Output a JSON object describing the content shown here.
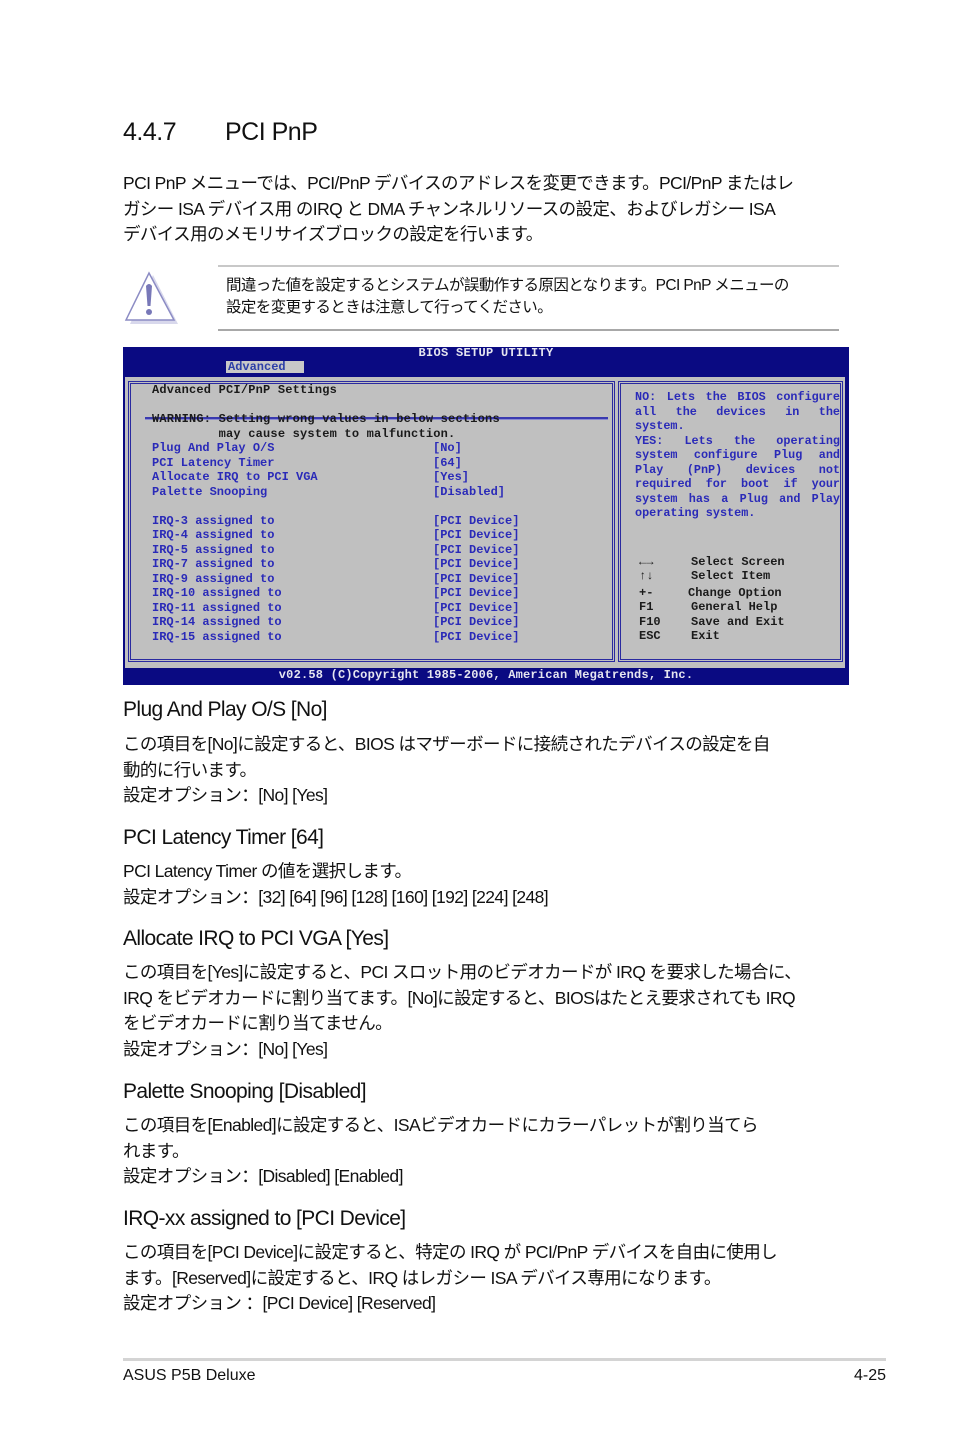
{
  "section": {
    "number": "4.4.7",
    "title": "PCI PnP"
  },
  "intro": [
    "PCI PnP メニューでは、PCI/PnP デバイスのアドレスを変更できます。PCI/PnP またはレ",
    "ガシー ISA デバイス用 のIRQ と DMA チャンネルリソースの設定、およびレガシー ISA",
    "デバイス用のメモリサイズブロックの設定を行います。"
  ],
  "note": {
    "icon": "warning-triangle-icon",
    "lines": [
      "間違った値を設定するとシステムが誤動作する原因となります。PCI PnP メニューの",
      "設定を変更するときは注意して行ってください。"
    ]
  },
  "bios": {
    "title": "BIOS SETUP UTILITY",
    "active_tab": "Advanced",
    "panel_title": "Advanced PCI/PnP Settings",
    "warning_lines": [
      "WARNING: Setting wrong values in below sections",
      "         may cause system to malfunction."
    ],
    "settings": [
      {
        "label": "Plug And Play O/S",
        "value": "[No]"
      },
      {
        "label": "PCI Latency Timer",
        "value": "[64]"
      },
      {
        "label": "Allocate IRQ to PCI VGA",
        "value": "[Yes]"
      },
      {
        "label": "Palette Snooping",
        "value": "[Disabled]"
      }
    ],
    "irq_settings": [
      {
        "label": "IRQ-3 assigned to",
        "value": "[PCI Device]"
      },
      {
        "label": "IRQ-4 assigned to",
        "value": "[PCI Device]"
      },
      {
        "label": "IRQ-5 assigned to",
        "value": "[PCI Device]"
      },
      {
        "label": "IRQ-7 assigned to",
        "value": "[PCI Device]"
      },
      {
        "label": "IRQ-9 assigned to",
        "value": "[PCI Device]"
      },
      {
        "label": "IRQ-10 assigned to",
        "value": "[PCI Device]"
      },
      {
        "label": "IRQ-11 assigned to",
        "value": "[PCI Device]"
      },
      {
        "label": "IRQ-14 assigned to",
        "value": "[PCI Device]"
      },
      {
        "label": "IRQ-15 assigned to",
        "value": "[PCI Device]"
      }
    ],
    "help_text": "NO: Lets the BIOS configure all the devices in the system. YES: Lets the operating system configure Plug and Play (PnP) devices not required for boot if your system has a Plug and Play operating system.",
    "help_lines": [
      "NO: Lets the BIOS configure all the devices in the system.",
      "YES: Lets the operating system configure Plug and Play (PnP) devices not required for boot if your system has a Plug and Play operating system."
    ],
    "keys": [
      {
        "key": "←→",
        "icon": "left-right-arrows-icon",
        "desc": "Select Screen"
      },
      {
        "key": "↑↓",
        "icon": "up-down-arrows-icon",
        "desc": "Select Item"
      },
      {
        "key": "+-",
        "desc": "Change Option"
      },
      {
        "key": "F1",
        "desc": "General Help"
      },
      {
        "key": "F10",
        "desc": "Save and Exit"
      },
      {
        "key": "ESC",
        "desc": "Exit"
      }
    ],
    "footer": "v02.58 (C)Copyright 1985-2006, American Megatrends, Inc.",
    "colors": {
      "frame": "#0a0a82",
      "body": "#c0c0c0",
      "item_text": "#2a2ab8",
      "tab_bg": "#c8c8c8"
    }
  },
  "items": [
    {
      "heading": "Plug And Play O/S [No]",
      "lines": [
        "この項目を[No]に設定すると、BIOS はマザーボードに接続されたデバイスの設定を自",
        "動的に行います。",
        "設定オプション：[No] [Yes]"
      ]
    },
    {
      "heading": "PCI Latency Timer [64]",
      "lines": [
        "PCI Latency Timer の値を選択します。",
        "設定オプション：[32] [64] [96] [128] [160] [192] [224] [248]"
      ]
    },
    {
      "heading": "Allocate IRQ to PCI VGA [Yes]",
      "lines": [
        "この項目を[Yes]に設定すると、PCI スロット用のビデオカードが IRQ を要求した場合に、",
        "IRQ をビデオカードに割り当てます。[No]に設定すると、BIOSはたとえ要求されても IRQ",
        "をビデオカードに割り当てません。",
        "設定オプション：[No] [Yes]"
      ]
    },
    {
      "heading": "Palette Snooping [Disabled]",
      "lines": [
        "この項目を[Enabled]に設定すると、ISAビデオカードにカラーパレットが割り当てら",
        "れます。",
        "設定オプション：[Disabled] [Enabled]"
      ]
    },
    {
      "heading": "IRQ-xx assigned to [PCI Device]",
      "lines": [
        "この項目を[PCI Device]に設定すると、特定の IRQ が PCI/PnP デバイスを自由に使用し",
        "ます。[Reserved]に設定すると、IRQ はレガシー ISA デバイス専用になります。",
        "設定オプション ：[PCI Device] [Reserved]"
      ]
    }
  ],
  "footer": {
    "product": "ASUS P5B Deluxe",
    "page_number": "4-25"
  }
}
